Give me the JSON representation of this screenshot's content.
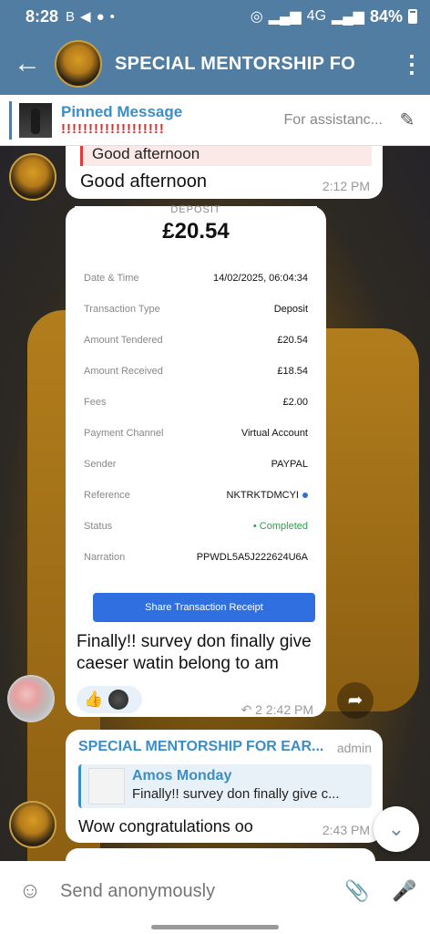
{
  "status_bar": {
    "time": "8:28",
    "icons_left": [
      "B",
      "◀",
      "●",
      "•"
    ],
    "network": "4G",
    "battery": "84%"
  },
  "header": {
    "title": "SPECIAL MENTORSHIP FO",
    "back_icon": "back-arrow-icon",
    "menu_icon": "more-vert-icon"
  },
  "pinned": {
    "label": "Pinned Message",
    "text": "!!!!!!!!!!!!!!!!!!!",
    "preview": "For assistanc..."
  },
  "messages": {
    "m1": {
      "reply_text": "Good afternoon",
      "text": "Good afternoon",
      "time": "2:12 PM"
    },
    "receipt": {
      "header_label": "DEPOSIT",
      "amount": "£20.54",
      "rows": [
        {
          "key": "Date & Time",
          "value": "14/02/2025, 06:04:34"
        },
        {
          "key": "Transaction Type",
          "value": "Deposit"
        },
        {
          "key": "Amount Tendered",
          "value": "£20.54"
        },
        {
          "key": "Amount Received",
          "value": "£18.54"
        },
        {
          "key": "Fees",
          "value": "£2.00"
        },
        {
          "key": "Payment Channel",
          "value": "Virtual Account"
        },
        {
          "key": "Sender",
          "value": "PAYPAL"
        },
        {
          "key": "Reference",
          "value": "NKTRKTDMCYI"
        },
        {
          "key": "Status",
          "value": "• Completed"
        },
        {
          "key": "Narration",
          "value": "PPWDL5A5J222624U6A"
        }
      ],
      "share_button": "Share Transaction Receipt"
    },
    "m2": {
      "caption": "Finally!! survey don finally give caeser watin belong to am",
      "reaction_emoji": "👍",
      "forwards": "↶ 2",
      "time": "2:42 PM"
    },
    "m3": {
      "sender": "SPECIAL MENTORSHIP FOR EAR...",
      "role": "admin",
      "quote_name": "Amos Monday",
      "quote_text": "Finally!! survey don finally give c...",
      "text": "Wow congratulations oo",
      "time": "2:43 PM"
    }
  },
  "input": {
    "placeholder": "Send anonymously"
  },
  "colors": {
    "header": "#517da2",
    "link": "#3a8ec8",
    "share_button": "#2f6fe0",
    "completed": "#2e9e4f"
  }
}
